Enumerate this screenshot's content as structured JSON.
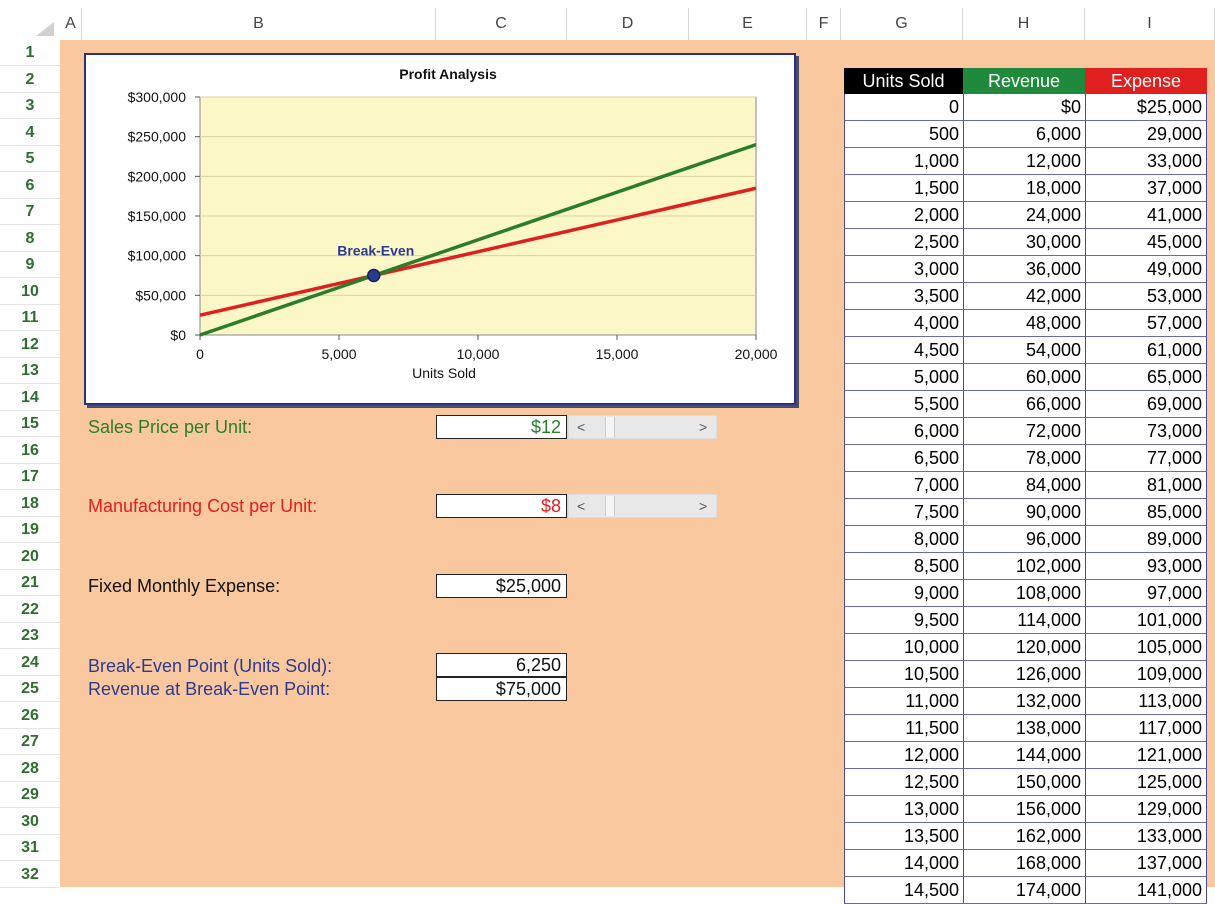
{
  "columns": [
    "A",
    "B",
    "C",
    "D",
    "E",
    "F",
    "G",
    "H",
    "I"
  ],
  "rows": [
    "1",
    "2",
    "3",
    "4",
    "5",
    "6",
    "7",
    "8",
    "9",
    "10",
    "11",
    "12",
    "13",
    "14",
    "15",
    "16",
    "17",
    "18",
    "19",
    "20",
    "21",
    "22",
    "23",
    "24",
    "25",
    "26",
    "27",
    "28",
    "29",
    "30",
    "31",
    "32"
  ],
  "colors": {
    "green": "#2a7d2a",
    "red": "#e0201e",
    "blue": "#2c3a8f",
    "sheet_bg": "#f9c89e",
    "plot_bg": "#fbf7c7"
  },
  "form": {
    "sales_price_label": "Sales Price per Unit:",
    "sales_price_value": "$12",
    "mfg_cost_label": "Manufacturing Cost per Unit:",
    "mfg_cost_value": "$8",
    "fixed_expense_label": "Fixed Monthly Expense:",
    "fixed_expense_value": "$25,000",
    "break_even_units_label": "Break-Even Point (Units Sold):",
    "break_even_units_value": "6,250",
    "break_even_revenue_label": "Revenue at Break-Even Point:",
    "break_even_revenue_value": "$75,000",
    "scroll_left": "<",
    "scroll_right": ">"
  },
  "table": {
    "headers": [
      "Units Sold",
      "Revenue",
      "Expense"
    ],
    "rows": [
      [
        "0",
        "$0",
        "$25,000"
      ],
      [
        "500",
        "6,000",
        "29,000"
      ],
      [
        "1,000",
        "12,000",
        "33,000"
      ],
      [
        "1,500",
        "18,000",
        "37,000"
      ],
      [
        "2,000",
        "24,000",
        "41,000"
      ],
      [
        "2,500",
        "30,000",
        "45,000"
      ],
      [
        "3,000",
        "36,000",
        "49,000"
      ],
      [
        "3,500",
        "42,000",
        "53,000"
      ],
      [
        "4,000",
        "48,000",
        "57,000"
      ],
      [
        "4,500",
        "54,000",
        "61,000"
      ],
      [
        "5,000",
        "60,000",
        "65,000"
      ],
      [
        "5,500",
        "66,000",
        "69,000"
      ],
      [
        "6,000",
        "72,000",
        "73,000"
      ],
      [
        "6,500",
        "78,000",
        "77,000"
      ],
      [
        "7,000",
        "84,000",
        "81,000"
      ],
      [
        "7,500",
        "90,000",
        "85,000"
      ],
      [
        "8,000",
        "96,000",
        "89,000"
      ],
      [
        "8,500",
        "102,000",
        "93,000"
      ],
      [
        "9,000",
        "108,000",
        "97,000"
      ],
      [
        "9,500",
        "114,000",
        "101,000"
      ],
      [
        "10,000",
        "120,000",
        "105,000"
      ],
      [
        "10,500",
        "126,000",
        "109,000"
      ],
      [
        "11,000",
        "132,000",
        "113,000"
      ],
      [
        "11,500",
        "138,000",
        "117,000"
      ],
      [
        "12,000",
        "144,000",
        "121,000"
      ],
      [
        "12,500",
        "150,000",
        "125,000"
      ],
      [
        "13,000",
        "156,000",
        "129,000"
      ],
      [
        "13,500",
        "162,000",
        "133,000"
      ],
      [
        "14,000",
        "168,000",
        "137,000"
      ],
      [
        "14,500",
        "174,000",
        "141,000"
      ]
    ]
  },
  "chart_data": {
    "type": "line",
    "title": "Profit Analysis",
    "xlabel": "Units Sold",
    "ylabel": "",
    "xlim": [
      0,
      20000
    ],
    "ylim": [
      0,
      300000
    ],
    "x_ticks": [
      "0",
      "5,000",
      "10,000",
      "15,000",
      "20,000"
    ],
    "x_tick_values": [
      0,
      5000,
      10000,
      15000,
      20000
    ],
    "y_ticks": [
      "$300,000",
      "$250,000",
      "$200,000",
      "$150,000",
      "$100,000",
      "$50,000",
      "$0"
    ],
    "y_tick_values": [
      300000,
      250000,
      200000,
      150000,
      100000,
      50000,
      0
    ],
    "grid": true,
    "series": [
      {
        "color": "#2a7d2a",
        "x": [
          0,
          20000
        ],
        "y": [
          0,
          240000
        ]
      },
      {
        "color": "#e0201e",
        "x": [
          0,
          20000
        ],
        "y": [
          25000,
          185000
        ]
      }
    ],
    "annotation": {
      "label": "Break-Even",
      "x": 6250,
      "y": 75000
    }
  }
}
